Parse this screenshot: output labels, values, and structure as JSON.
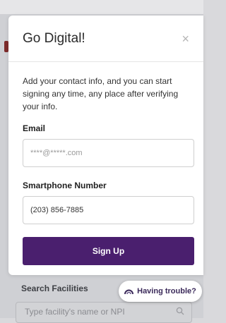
{
  "modal": {
    "title": "Go Digital!",
    "close_symbol": "×",
    "intro": "Add your contact info, and you can start signing any time, any place after verifying your info.",
    "email": {
      "label": "Email",
      "placeholder": "****@*****.com"
    },
    "phone": {
      "label": "Smartphone Number",
      "value": "(203) 856-7885"
    },
    "signup_label": "Sign Up"
  },
  "background": {
    "search_label": "Search Facilities",
    "search_placeholder": "Type facility's name or NPI"
  },
  "help": {
    "label": "Having trouble?"
  },
  "colors": {
    "primary": "#4a1f6e",
    "overlay": "#cfd0d4"
  },
  "icons": {
    "close": "close-icon",
    "search": "search-icon",
    "help": "rainbow-icon"
  }
}
